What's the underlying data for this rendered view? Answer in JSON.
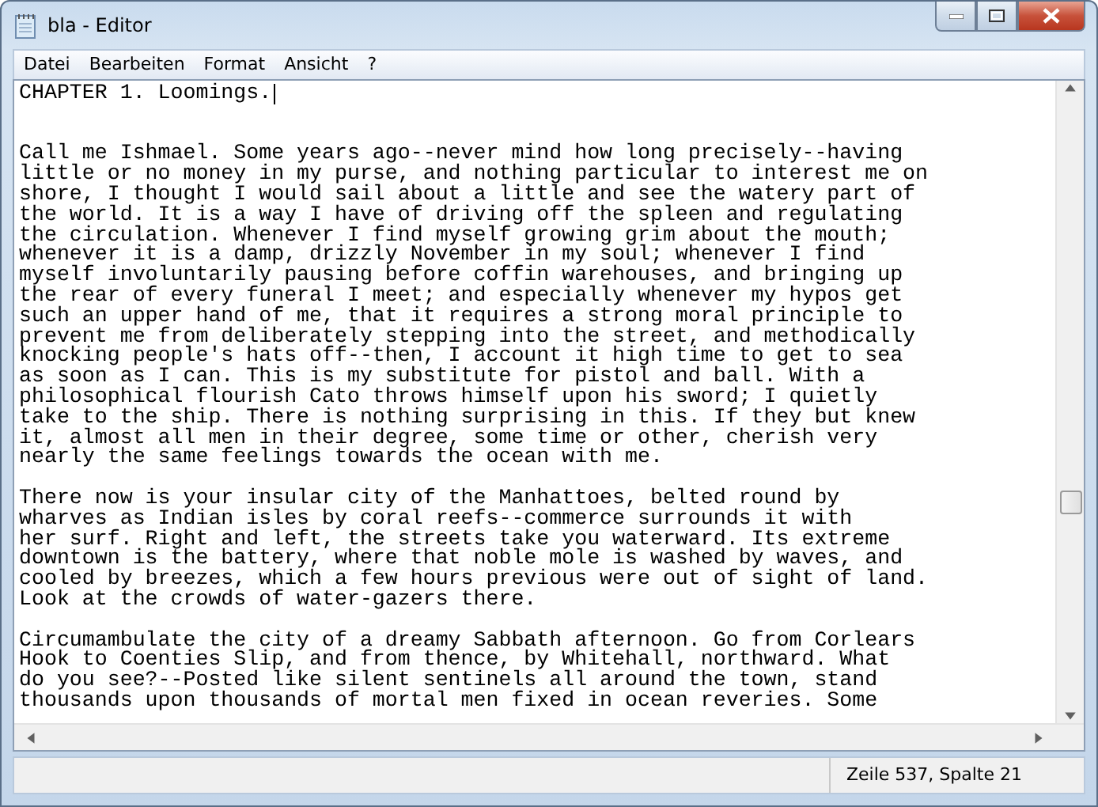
{
  "window": {
    "title": "bla - Editor"
  },
  "menu": [
    "Datei",
    "Bearbeiten",
    "Format",
    "Ansicht",
    "?"
  ],
  "editor": {
    "paragraphs": [
      {
        "kind": "heading",
        "lines": [
          "CHAPTER 1. Loomings."
        ]
      },
      {
        "kind": "body",
        "lines": [
          "Call me Ishmael. Some years ago--never mind how long precisely--having",
          "little or no money in my purse, and nothing particular to interest me on",
          "shore, I thought I would sail about a little and see the watery part of",
          "the world. It is a way I have of driving off the spleen and regulating",
          "the circulation. Whenever I find myself growing grim about the mouth;",
          "whenever it is a damp, drizzly November in my soul; whenever I find",
          "myself involuntarily pausing before coffin warehouses, and bringing up",
          "the rear of every funeral I meet; and especially whenever my hypos get",
          "such an upper hand of me, that it requires a strong moral principle to",
          "prevent me from deliberately stepping into the street, and methodically",
          "knocking people's hats off--then, I account it high time to get to sea",
          "as soon as I can. This is my substitute for pistol and ball. With a",
          "philosophical flourish Cato throws himself upon his sword; I quietly",
          "take to the ship. There is nothing surprising in this. If they but knew",
          "it, almost all men in their degree, some time or other, cherish very",
          "nearly the same feelings towards the ocean with me."
        ]
      },
      {
        "kind": "body",
        "lines": [
          "There now is your insular city of the Manhattoes, belted round by",
          "wharves as Indian isles by coral reefs--commerce surrounds it with",
          "her surf. Right and left, the streets take you waterward. Its extreme",
          "downtown is the battery, where that noble mole is washed by waves, and",
          "cooled by breezes, which a few hours previous were out of sight of land.",
          "Look at the crowds of water-gazers there."
        ]
      },
      {
        "kind": "body",
        "lines": [
          "Circumambulate the city of a dreamy Sabbath afternoon. Go from Corlears",
          "Hook to Coenties Slip, and from thence, by Whitehall, northward. What",
          "do you see?--Posted like silent sentinels all around the town, stand",
          "thousands upon thousands of mortal men fixed in ocean reveries. Some"
        ]
      }
    ]
  },
  "status_bar": {
    "position": "Zeile 537, Spalte 21"
  }
}
